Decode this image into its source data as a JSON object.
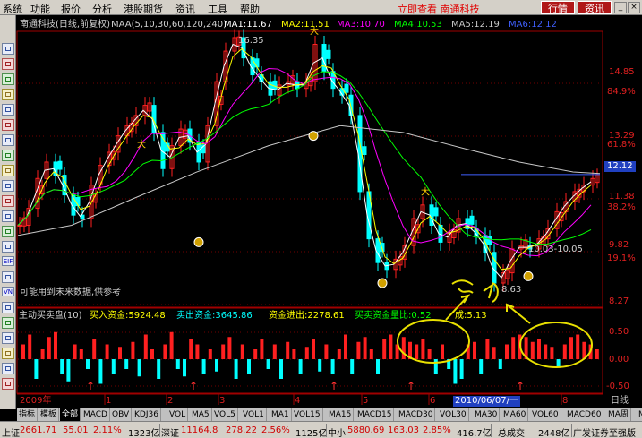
{
  "menu": {
    "items": [
      "系统",
      "功能",
      "报价",
      "分析",
      "港股期货",
      "资讯",
      "工具",
      "帮助"
    ],
    "title_text": "立即查看 南通科技"
  },
  "top_buttons": [
    "行情",
    "资讯"
  ],
  "window_buttons": [
    "_",
    "▫",
    "×"
  ],
  "toolbar": {
    "text_icons": [
      "EIF",
      "VN"
    ]
  },
  "chart_header": {
    "security": "南通科技(日线,前复权)",
    "ma_param": "MAA(5,10,30,60,120,240)",
    "ma_values": [
      {
        "label": "MA1:11.67",
        "color": "#ffffff"
      },
      {
        "label": "MA2:11.51",
        "color": "#ffff00"
      },
      {
        "label": "MA3:10.70",
        "color": "#ff00ff"
      },
      {
        "label": "MA4:10.53",
        "color": "#00ff00"
      },
      {
        "label": "MA5:12.19",
        "color": "#c8c8c8"
      },
      {
        "label": "MA6:12.12",
        "color": "#4060ff"
      }
    ]
  },
  "price_axis": {
    "ticks": [
      "14.85",
      "13.29",
      "11.38",
      "9.82",
      "8.27"
    ],
    "pcts": [
      "84.9%",
      "61.8%",
      "38.2%",
      "19.1%"
    ],
    "current": "12.12"
  },
  "annotations": {
    "high": "16.35",
    "low": "8.63",
    "range": "10.03-10.05",
    "note": "可能用到未来数据,供参考"
  },
  "lower_pane": {
    "name": "主动买卖盘(10)",
    "buy": "买入资金:5924.48",
    "sell": "卖出资金:3645.86",
    "net": "资金进出:2278.61",
    "ratio": "买卖资金量比:0.52",
    "extra": "成:5.13",
    "ticks": [
      "0.50",
      "0.00",
      "-0.50"
    ]
  },
  "x_axis": {
    "year": "2009年",
    "months": [
      "1",
      "2",
      "3",
      "4",
      "5",
      "6",
      "8"
    ],
    "cursor_date": "2010/06/07/一",
    "period": "日线"
  },
  "handwriting": "主力",
  "tabs": [
    "指标",
    "模板",
    "全部",
    "MACD",
    "OBV",
    "KDJ36",
    "VOL",
    "MA5",
    "VOL5",
    "VOL1",
    "MA1",
    "VOL15",
    "MA15",
    "MACD15",
    "MACD30",
    "VOL30",
    "MA30",
    "MA60",
    "VOL60",
    "MACD60",
    "MA周",
    "MAA"
  ],
  "status": {
    "sh_label": "上证",
    "sh_index": "2661.71",
    "sh_chg": "55.01",
    "sh_pct": "2.11%",
    "sh_vol": "1323亿",
    "sz_label": "深证",
    "sz_index": "11164.8",
    "sz_chg": "278.22",
    "sz_pct": "2.56%",
    "sz_vol": "1125亿",
    "zx_label": "中小",
    "zx_index": "5880.69",
    "zx_chg": "163.03",
    "zx_pct": "2.85%",
    "zx_vol": "416.7亿",
    "total_label": "总成交",
    "total_vol": "2448亿",
    "broker": "广发证券至强版"
  },
  "colors": {
    "up": "#ff2020",
    "down": "#00ffff",
    "bg": "#000000"
  },
  "chart_data": {
    "type": "candlestick",
    "axis_ticks": [
      8.27,
      9.82,
      11.38,
      13.29,
      14.85
    ],
    "high": 16.35,
    "low": 8.63,
    "last": 12.12,
    "current_label": "12.12"
  }
}
